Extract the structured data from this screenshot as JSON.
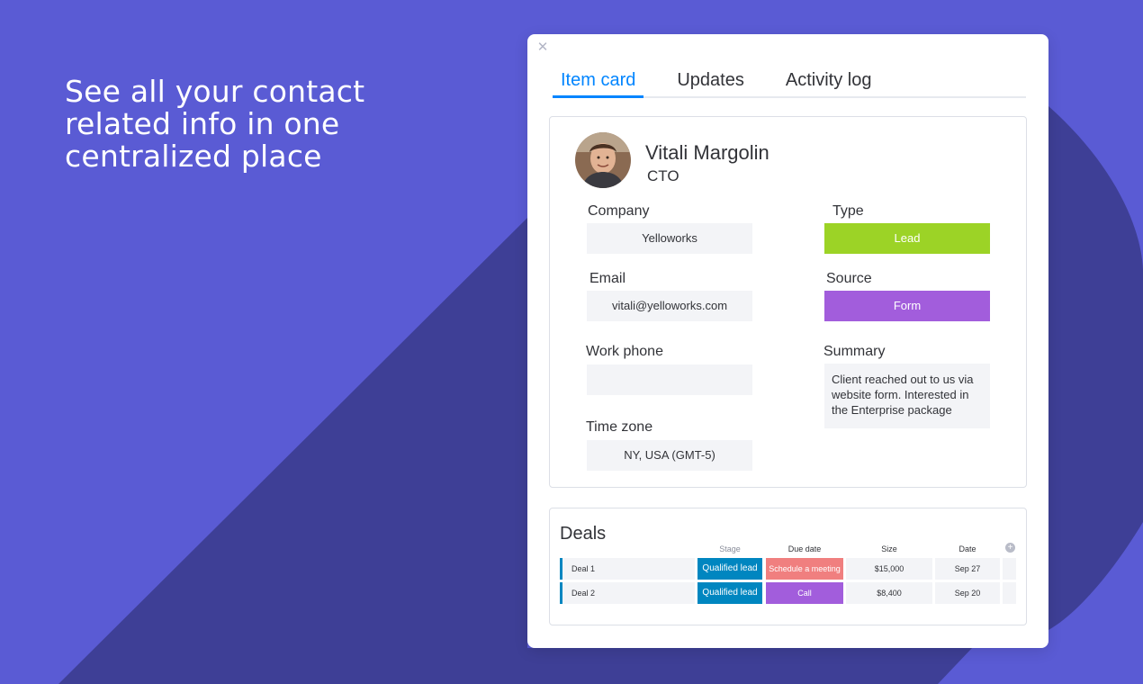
{
  "marketing": {
    "headline_line1": "See all your contact",
    "headline_line2": "related info in one",
    "headline_line3": "centralized place"
  },
  "colors": {
    "background": "#5a5bd4",
    "background_shape": "#3e3f96",
    "accent": "#0085ff",
    "lead": "#9cd326",
    "form": "#a25ddc",
    "qualified_lead": "#0086c0",
    "schedule_meeting": "#f07f7f",
    "call": "#a25ddc"
  },
  "modal": {
    "close_icon": "close-icon",
    "close_glyph": "✕",
    "tabs": [
      "Item card",
      "Updates",
      "Activity log"
    ]
  },
  "contact": {
    "name": "Vitali Margolin",
    "title": "CTO",
    "avatar_icon": "avatar-photo",
    "fields": {
      "company_label": "Company",
      "company_value": "Yelloworks",
      "type_label": "Type",
      "type_value": "Lead",
      "email_label": "Email",
      "email_value": "vitali@yelloworks.com",
      "source_label": "Source",
      "source_value": "Form",
      "work_phone_label": "Work phone",
      "work_phone_value": "",
      "summary_label": "Summary",
      "summary_value": "Client reached out to us via website form. Interested in the Enterprise package",
      "time_zone_label": "Time zone",
      "time_zone_value": "NY, USA (GMT-5)"
    }
  },
  "deals": {
    "title": "Deals",
    "add_icon": "plus-circle-icon",
    "add_glyph": "+",
    "columns": [
      "Stage",
      "Due date",
      "Size",
      "Date"
    ],
    "rows": [
      {
        "name": "Deal 1",
        "stage": "Qualified lead",
        "due": "Schedule a meeting",
        "size": "$15,000",
        "date": "Sep 27"
      },
      {
        "name": "Deal 2",
        "stage": "Qualified lead",
        "due": "Call",
        "size": "$8,400",
        "date": "Sep 20"
      }
    ]
  }
}
